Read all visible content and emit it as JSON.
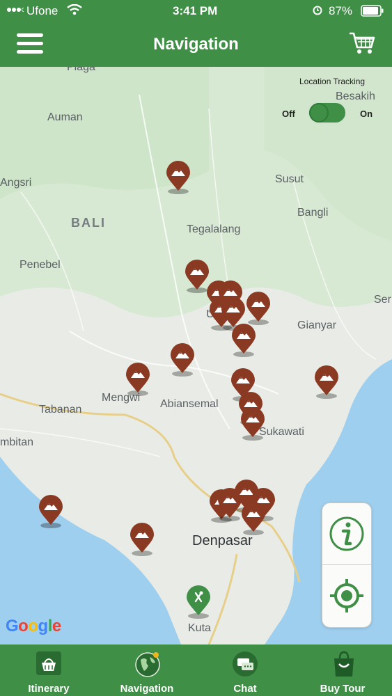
{
  "status_bar": {
    "carrier": "Ufone",
    "time": "3:41 PM",
    "battery": "87%"
  },
  "header": {
    "title": "Navigation",
    "menu_icon": "hamburger-icon",
    "cart_icon": "cart-icon"
  },
  "map": {
    "labels": {
      "plaga": "Plaga",
      "auman": "Auman",
      "besakih": "Besakih",
      "angsri": "Angsri",
      "susut": "Susut",
      "bali": "BALI",
      "bangli": "Bangli",
      "tegalalang": "Tegalalang",
      "penebel": "Penebel",
      "ser": "Ser",
      "gianyar": "Gianyar",
      "ubud": "U",
      "tabanan": "Tabanan",
      "mengwi": "Mengwi",
      "abiansemal": "Abiansemal",
      "sukawati": "Sukawati",
      "kediri": "mbitan",
      "denpasar": "Denpasar",
      "kuta": "Kuta"
    },
    "pin_icon": "mountain-pin-icon",
    "restaurant_pin_icon": "restaurant-pin-icon",
    "attribution": "Google"
  },
  "location_tracking": {
    "label": "Location Tracking",
    "off": "Off",
    "on": "On",
    "state": "on"
  },
  "controls": {
    "info_icon": "info-icon",
    "locate_icon": "crosshair-icon"
  },
  "tabs": [
    {
      "label": "Itinerary",
      "icon": "basket-icon"
    },
    {
      "label": "Navigation",
      "icon": "globe-icon",
      "active": true
    },
    {
      "label": "Chat",
      "icon": "chat-icon"
    },
    {
      "label": "Buy Tour",
      "icon": "shopping-bag-icon"
    }
  ],
  "colors": {
    "brand_green": "#3f8f47",
    "pin_brown": "#8a3a22",
    "water": "#9fcfee",
    "land": "#e9ece6"
  }
}
